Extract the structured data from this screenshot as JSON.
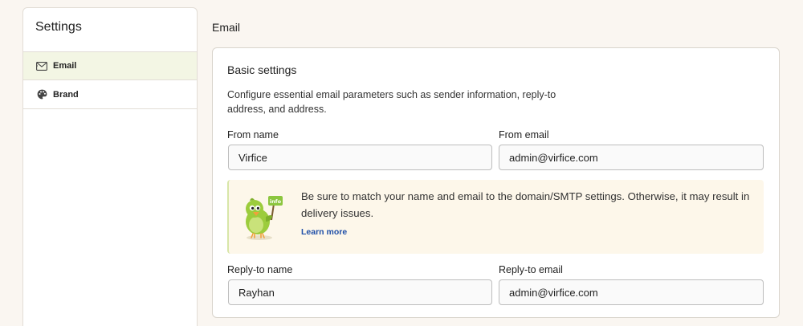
{
  "sidebar": {
    "title": "Settings",
    "items": [
      {
        "label": "Email",
        "icon": "envelope-icon",
        "active": true
      },
      {
        "label": "Brand",
        "icon": "palette-icon",
        "active": false
      }
    ]
  },
  "main": {
    "section_title": "Email",
    "card": {
      "title": "Basic settings",
      "description": "Configure essential email parameters such as sender information, reply-to address, and address.",
      "fields": {
        "from_name": {
          "label": "From name",
          "value": "Virfice"
        },
        "from_email": {
          "label": "From email",
          "value": "admin@virfice.com"
        },
        "reply_to_name": {
          "label": "Reply-to name",
          "value": "Rayhan"
        },
        "reply_to_email": {
          "label": "Reply-to email",
          "value": "admin@virfice.com"
        }
      },
      "info": {
        "badge": "info",
        "message": "Be sure to match your name and email to the domain/SMTP settings. Otherwise, it may result in delivery issues.",
        "link": "Learn more"
      }
    }
  },
  "colors": {
    "page_bg": "#faf6f1",
    "active_nav_bg": "#f3f6e4",
    "info_bg": "#fdf7ea",
    "link": "#1f4fa8"
  }
}
